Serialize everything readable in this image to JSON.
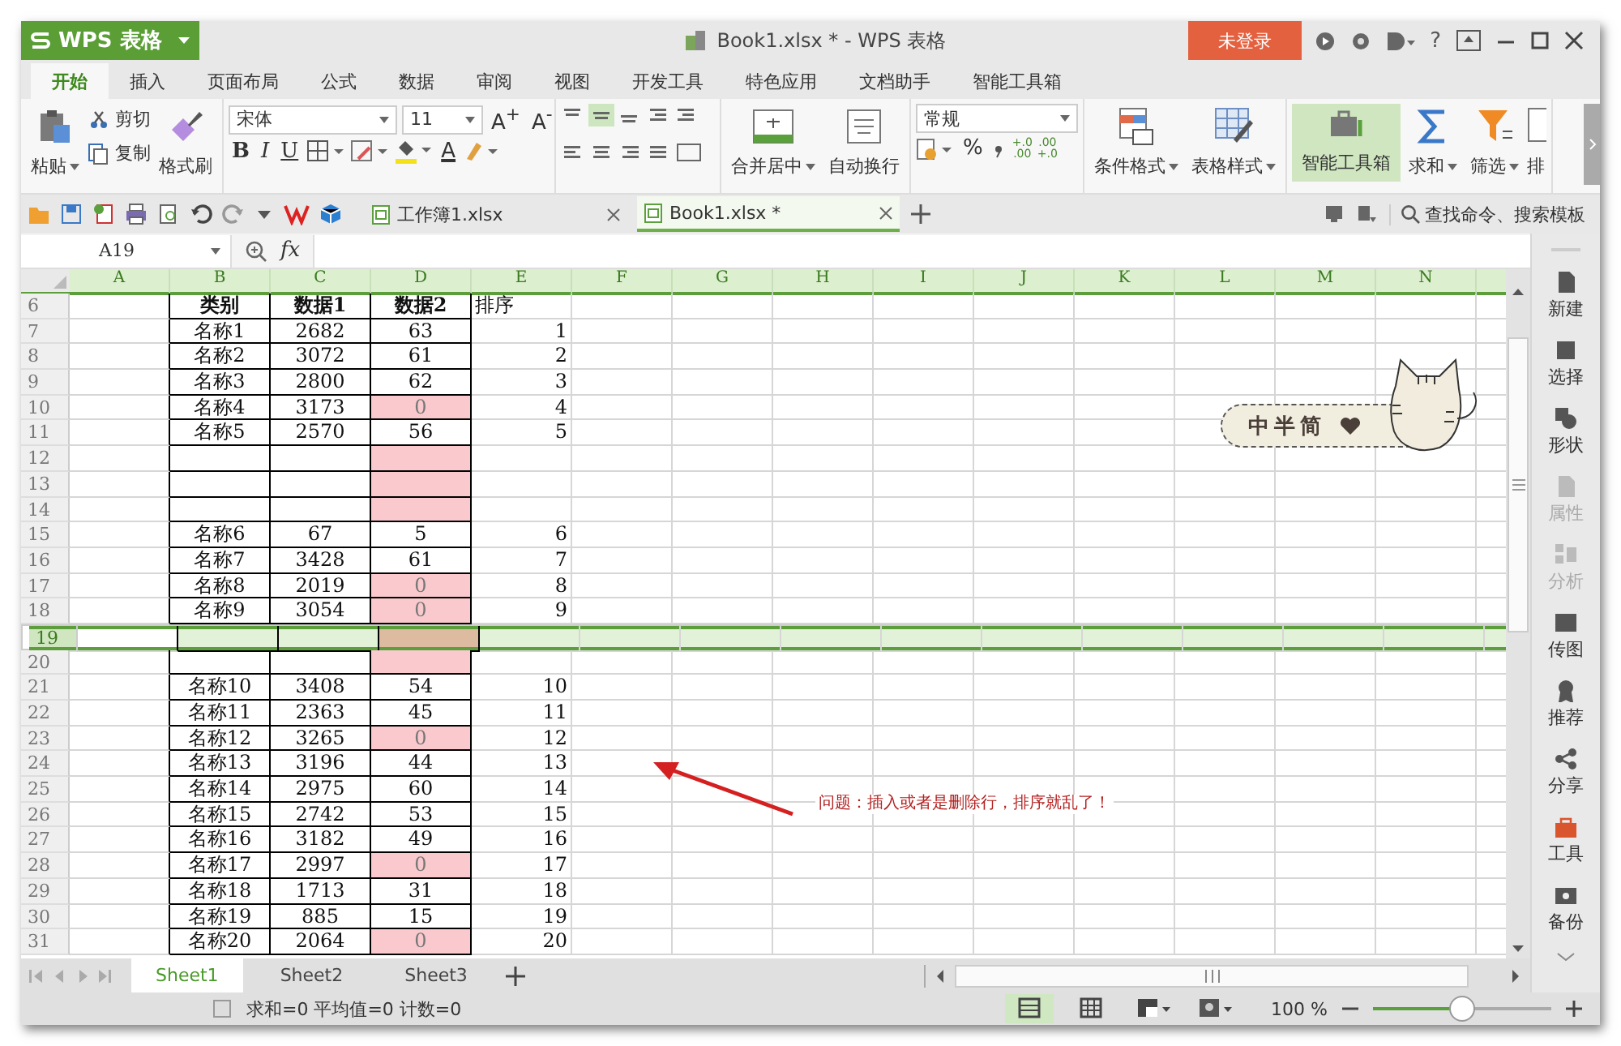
{
  "app_button": {
    "label": "WPS 表格"
  },
  "window": {
    "title": "Book1.xlsx * - WPS 表格"
  },
  "login_button": {
    "label": "未登录"
  },
  "help": "?",
  "menu_tabs": [
    {
      "label": "开始",
      "selected": true
    },
    {
      "label": "插入",
      "selected": false
    },
    {
      "label": "页面布局",
      "selected": false
    },
    {
      "label": "公式",
      "selected": false
    },
    {
      "label": "数据",
      "selected": false
    },
    {
      "label": "审阅",
      "selected": false
    },
    {
      "label": "视图",
      "selected": false
    },
    {
      "label": "开发工具",
      "selected": false
    },
    {
      "label": "特色应用",
      "selected": false
    },
    {
      "label": "文档助手",
      "selected": false
    },
    {
      "label": "智能工具箱",
      "selected": false
    }
  ],
  "ribbon": {
    "paste": "粘贴",
    "cut": "剪切",
    "copy": "复制",
    "format_painter": "格式刷",
    "font_family": "宋体",
    "font_size": "11",
    "size_buttons": [
      "A$^{+}$",
      "A$^{-}$"
    ],
    "styles": [
      "B",
      "I",
      "U"
    ],
    "font_color": "A",
    "merge": "合并居中",
    "wrap": "自动换行",
    "number_format": "常规",
    "percent": "%",
    "decimal_buttons": [
      [
        "+.0",
        ".00"
      ],
      [
        ".00",
        "+.0"
      ]
    ],
    "conditional": "条件格式",
    "table_style": "表格样式",
    "toolbox": {
      "label": "智能工具箱",
      "selected": true
    },
    "sum": "求和",
    "filter": "筛选",
    "sort": "排"
  },
  "doc_tabs": [
    {
      "label": "工作簿1.xlsx",
      "selected": false
    },
    {
      "label": "Book1.xlsx *",
      "selected": true
    }
  ],
  "search": {
    "placeholder": "查找命令、搜索模板"
  },
  "formula_bar": {
    "cell": "A19",
    "fx": "fx"
  },
  "columns": [
    "A",
    "B",
    "C",
    "D",
    "E",
    "F",
    "G",
    "H",
    "I",
    "J",
    "K",
    "L",
    "M",
    "N"
  ],
  "rows": [
    {
      "row": "6",
      "kind": "header",
      "b": "类别",
      "c": "数据1",
      "d": "数据2",
      "e": "排序",
      "highlighted": false,
      "selected": false
    },
    {
      "row": "7",
      "kind": "data",
      "b": "名称1",
      "c": "2682",
      "d": "63",
      "e": "1",
      "highlighted": false,
      "selected": false
    },
    {
      "row": "8",
      "kind": "data",
      "b": "名称2",
      "c": "3072",
      "d": "61",
      "e": "2",
      "highlighted": false,
      "selected": false
    },
    {
      "row": "9",
      "kind": "data",
      "b": "名称3",
      "c": "2800",
      "d": "62",
      "e": "3",
      "highlighted": false,
      "selected": false
    },
    {
      "row": "10",
      "kind": "data",
      "b": "名称4",
      "c": "3173",
      "d": "0",
      "e": "4",
      "highlighted": true,
      "selected": false
    },
    {
      "row": "11",
      "kind": "data",
      "b": "名称5",
      "c": "2570",
      "d": "56",
      "e": "5",
      "highlighted": false,
      "selected": false
    },
    {
      "row": "12",
      "kind": "data",
      "highlighted": true,
      "selected": false
    },
    {
      "row": "13",
      "kind": "data",
      "highlighted": true,
      "selected": false
    },
    {
      "row": "14",
      "kind": "data",
      "highlighted": true,
      "selected": false
    },
    {
      "row": "15",
      "kind": "data",
      "b": "名称6",
      "c": "67",
      "d": "5",
      "e": "6",
      "highlighted": false,
      "selected": false
    },
    {
      "row": "16",
      "kind": "data",
      "b": "名称7",
      "c": "3428",
      "d": "61",
      "e": "7",
      "highlighted": false,
      "selected": false
    },
    {
      "row": "17",
      "kind": "data",
      "b": "名称8",
      "c": "2019",
      "d": "0",
      "e": "8",
      "highlighted": true,
      "selected": false
    },
    {
      "row": "18",
      "kind": "data",
      "b": "名称9",
      "c": "3054",
      "d": "0",
      "e": "9",
      "highlighted": true,
      "selected": false
    },
    {
      "row": "19",
      "kind": "data",
      "highlighted": true,
      "selected": true
    },
    {
      "row": "20",
      "kind": "data",
      "highlighted": true,
      "selected": false
    },
    {
      "row": "21",
      "kind": "data",
      "b": "名称10",
      "c": "3408",
      "d": "54",
      "e": "10",
      "highlighted": false,
      "selected": false
    },
    {
      "row": "22",
      "kind": "data",
      "b": "名称11",
      "c": "2363",
      "d": "45",
      "e": "11",
      "highlighted": false,
      "selected": false
    },
    {
      "row": "23",
      "kind": "data",
      "b": "名称12",
      "c": "3265",
      "d": "0",
      "e": "12",
      "highlighted": true,
      "selected": false
    },
    {
      "row": "24",
      "kind": "data",
      "b": "名称13",
      "c": "3196",
      "d": "44",
      "e": "13",
      "highlighted": false,
      "selected": false
    },
    {
      "row": "25",
      "kind": "data",
      "b": "名称14",
      "c": "2975",
      "d": "60",
      "e": "14",
      "highlighted": false,
      "selected": false
    },
    {
      "row": "26",
      "kind": "data",
      "b": "名称15",
      "c": "2742",
      "d": "53",
      "e": "15",
      "highlighted": false,
      "selected": false
    },
    {
      "row": "27",
      "kind": "data",
      "b": "名称16",
      "c": "3182",
      "d": "49",
      "e": "16",
      "highlighted": false,
      "selected": false
    },
    {
      "row": "28",
      "kind": "data",
      "b": "名称17",
      "c": "2997",
      "d": "0",
      "e": "17",
      "highlighted": true,
      "selected": false
    },
    {
      "row": "29",
      "kind": "data",
      "b": "名称18",
      "c": "1713",
      "d": "31",
      "e": "18",
      "highlighted": false,
      "selected": false
    },
    {
      "row": "30",
      "kind": "data",
      "b": "名称19",
      "c": "885",
      "d": "15",
      "e": "19",
      "highlighted": false,
      "selected": false
    },
    {
      "row": "31",
      "kind": "data",
      "b": "名称20",
      "c": "2064",
      "d": "0",
      "e": "20",
      "highlighted": true,
      "selected": false
    }
  ],
  "sticker": {
    "text": "中半简"
  },
  "annotation": {
    "text": "问题：插入或者是删除行，排序就乱了！"
  },
  "side_panel": [
    {
      "label": "新建",
      "disabled": false
    },
    {
      "label": "选择",
      "disabled": false
    },
    {
      "label": "形状",
      "disabled": false
    },
    {
      "label": "属性",
      "disabled": true
    },
    {
      "label": "分析",
      "disabled": true
    },
    {
      "label": "传图",
      "disabled": false
    },
    {
      "label": "推荐",
      "disabled": false
    },
    {
      "label": "分享",
      "disabled": false
    },
    {
      "label": "工具",
      "disabled": false
    },
    {
      "label": "备份",
      "disabled": false
    }
  ],
  "sheet_tabs": [
    {
      "label": "Sheet1",
      "selected": true
    },
    {
      "label": "Sheet2",
      "selected": false
    },
    {
      "label": "Sheet3",
      "selected": false
    }
  ],
  "status": {
    "summary": "求和=0 平均值=0 计数=0",
    "zoom": "100 %",
    "level": 0.5
  }
}
